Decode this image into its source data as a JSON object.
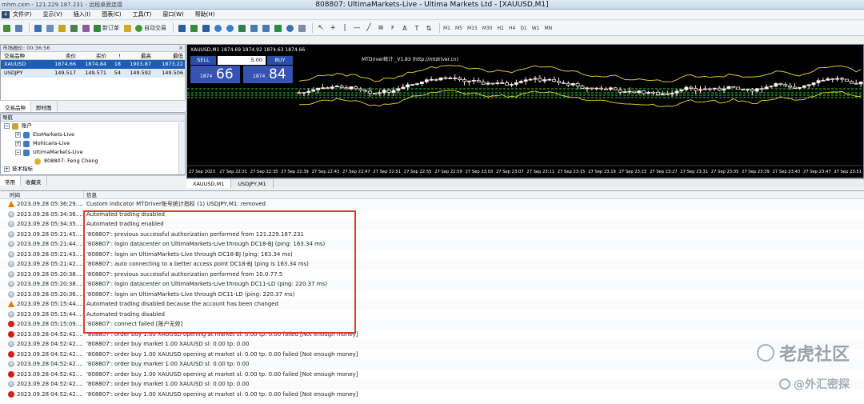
{
  "window": {
    "remote_title": "mhm.cxm - 121.229.187.231 - 远程桌面连接",
    "title": "808807: UltimaMarkets-Live - Ultima Markets Ltd - [XAUUSD,M1]"
  },
  "menu": [
    "文件(F)",
    "显示(V)",
    "插入(I)",
    "图表(C)",
    "工具(T)",
    "窗口(W)",
    "帮助(H)"
  ],
  "toolbar": {
    "new_order": "新订单",
    "auto_trading": "自动交易",
    "timeframes": [
      "M1",
      "M5",
      "M15",
      "M30",
      "H1",
      "H4",
      "D1",
      "W1",
      "MN"
    ]
  },
  "market_watch": {
    "title": "市场报价: 00:36:56",
    "columns": [
      "交易品种",
      "卖价",
      "买价",
      "!",
      "最高",
      "最低"
    ],
    "rows": [
      {
        "symbol": "XAUUSD",
        "bid": "1874.66",
        "ask": "1874.84",
        "spread": "18",
        "high": "1903.87",
        "low": "1873.22"
      },
      {
        "symbol": "USDJPY",
        "bid": "149.517",
        "ask": "149.571",
        "spread": "54",
        "high": "149.592",
        "low": "149.506"
      }
    ],
    "tabs": [
      "交易品种",
      "即时图"
    ]
  },
  "navigator": {
    "title": "导航",
    "items": [
      "账户",
      "EtoMarkets-Live",
      "Mohicans-Live",
      "UltimaMarkets-Live",
      "808807: Feng Cheng",
      "技术指标"
    ],
    "tabs": [
      "常用",
      "收藏夹"
    ]
  },
  "chart": {
    "symbol_info": "XAUUSD,M1  1874.69  1874.92  1874.63  1874.66",
    "sell_label": "SELL",
    "buy_label": "BUY",
    "lot": "5.00",
    "sell_price_small": "1874",
    "sell_price_big": "66",
    "buy_price_small": "1874",
    "buy_price_big": "84",
    "indicator_label": "MTDriver统计 _V1.83 (http://mtdriver.cn)",
    "time_labels": [
      "27 Sep 2023",
      "27 Sep 22:31",
      "27 Sep 22:35",
      "27 Sep 22:39",
      "27 Sep 22:43",
      "27 Sep 22:47",
      "27 Sep 22:51",
      "27 Sep 22:55",
      "27 Sep 22:59",
      "27 Sep 23:03",
      "27 Sep 23:07",
      "27 Sep 23:11",
      "27 Sep 23:15",
      "27 Sep 23:19",
      "27 Sep 23:23",
      "27 Sep 23:27",
      "27 Sep 23:31",
      "27 Sep 23:35",
      "27 Sep 23:39",
      "27 Sep 23:43",
      "27 Sep 23:47",
      "27 Sep 23:51"
    ],
    "tabs": [
      "XAUUSD,M1",
      "USDJPY,M1"
    ]
  },
  "journal": {
    "col_time": "时间",
    "col_msg": "信息",
    "rows": [
      {
        "type": "warn",
        "time": "2023.09.28 05:36:29....",
        "msg": "Custom indicator MTDriver账号统计指标 (1) USDJPY,M1: removed"
      },
      {
        "type": "info",
        "time": "2023.09.28 05:34:36....",
        "msg": "Automated trading disabled"
      },
      {
        "type": "info",
        "time": "2023.09.28 05:34:35....",
        "msg": "Automated trading enabled"
      },
      {
        "type": "info",
        "time": "2023.09.28 05:21:45....",
        "msg": "'808807': previous successful authorization performed from 121.229.187.231"
      },
      {
        "type": "info",
        "time": "2023.09.28 05:21:44....",
        "msg": "'808807': login datacenter on UltimaMarkets-Live through DC18-BJ (ping: 163.34 ms)"
      },
      {
        "type": "info",
        "time": "2023.09.28 05:21:43....",
        "msg": "'808807': login on UltimaMarkets-Live through DC18-BJ (ping: 163.34 ms)"
      },
      {
        "type": "info",
        "time": "2023.09.28 05:21:42....",
        "msg": "'808807': auto connecting to a better access point DC18-BJ (ping is 163.34 ms)"
      },
      {
        "type": "info",
        "time": "2023.09.28 05:20:38....",
        "msg": "'808807': previous successful authorization performed from 10.0.77.5"
      },
      {
        "type": "info",
        "time": "2023.09.28 05:20:38....",
        "msg": "'808807': login datacenter on UltimaMarkets-Live through DC11-LD (ping: 220.37 ms)"
      },
      {
        "type": "info",
        "time": "2023.09.28 05:20:36....",
        "msg": "'808807': login on UltimaMarkets-Live through DC11-LD (ping: 220.37 ms)"
      },
      {
        "type": "warn",
        "time": "2023.09.28 05:15:44....",
        "msg": "Automated trading disabled because the account has been changed"
      },
      {
        "type": "info",
        "time": "2023.09.28 05:15:44....",
        "msg": "Automated trading disabled"
      },
      {
        "type": "err",
        "time": "2023.09.28 05:15:09....",
        "msg": "'808807': connect failed [账户无效]"
      },
      {
        "type": "err",
        "time": "2023.09.28 04:52:42....",
        "msg": "'808807': order buy 1.00 XAUUSD opening at market sl: 0.00 tp: 0.00 failed [Not enough money]"
      },
      {
        "type": "info",
        "time": "2023.09.28 04:52:42....",
        "msg": "'808807': order buy market 1.00 XAUUSD sl: 0.00 tp: 0.00"
      },
      {
        "type": "err",
        "time": "2023.09.28 04:52:42....",
        "msg": "'808807': order buy 1.00 XAUUSD opening at market sl: 0.00 tp: 0.00 failed [Not enough money]"
      },
      {
        "type": "info",
        "time": "2023.09.28 04:52:42....",
        "msg": "'808807': order buy market 1.00 XAUUSD sl: 0.00 tp: 0.00"
      },
      {
        "type": "err",
        "time": "2023.09.28 04:52:42....",
        "msg": "'808807': order buy 1.00 XAUUSD opening at market sl: 0.00 tp: 0.00 failed [Not enough money]"
      },
      {
        "type": "info",
        "time": "2023.09.28 04:52:42....",
        "msg": "'808807': order buy market 1.00 XAUUSD sl: 0.00 tp: 0.00"
      },
      {
        "type": "err",
        "time": "2023.09.28 04:52:42....",
        "msg": "'808807': order buy 1.00 XAUUSD opening at market sl: 0.00 tp: 0.00 failed [Not enough money]"
      }
    ]
  },
  "watermarks": [
    "老虎社区",
    "@外汇密探"
  ],
  "colors": {
    "accent_blue": "#1c5db8",
    "error_red": "#d21e1e",
    "warn_orange": "#e07a10",
    "highlight": "#e03a30"
  }
}
